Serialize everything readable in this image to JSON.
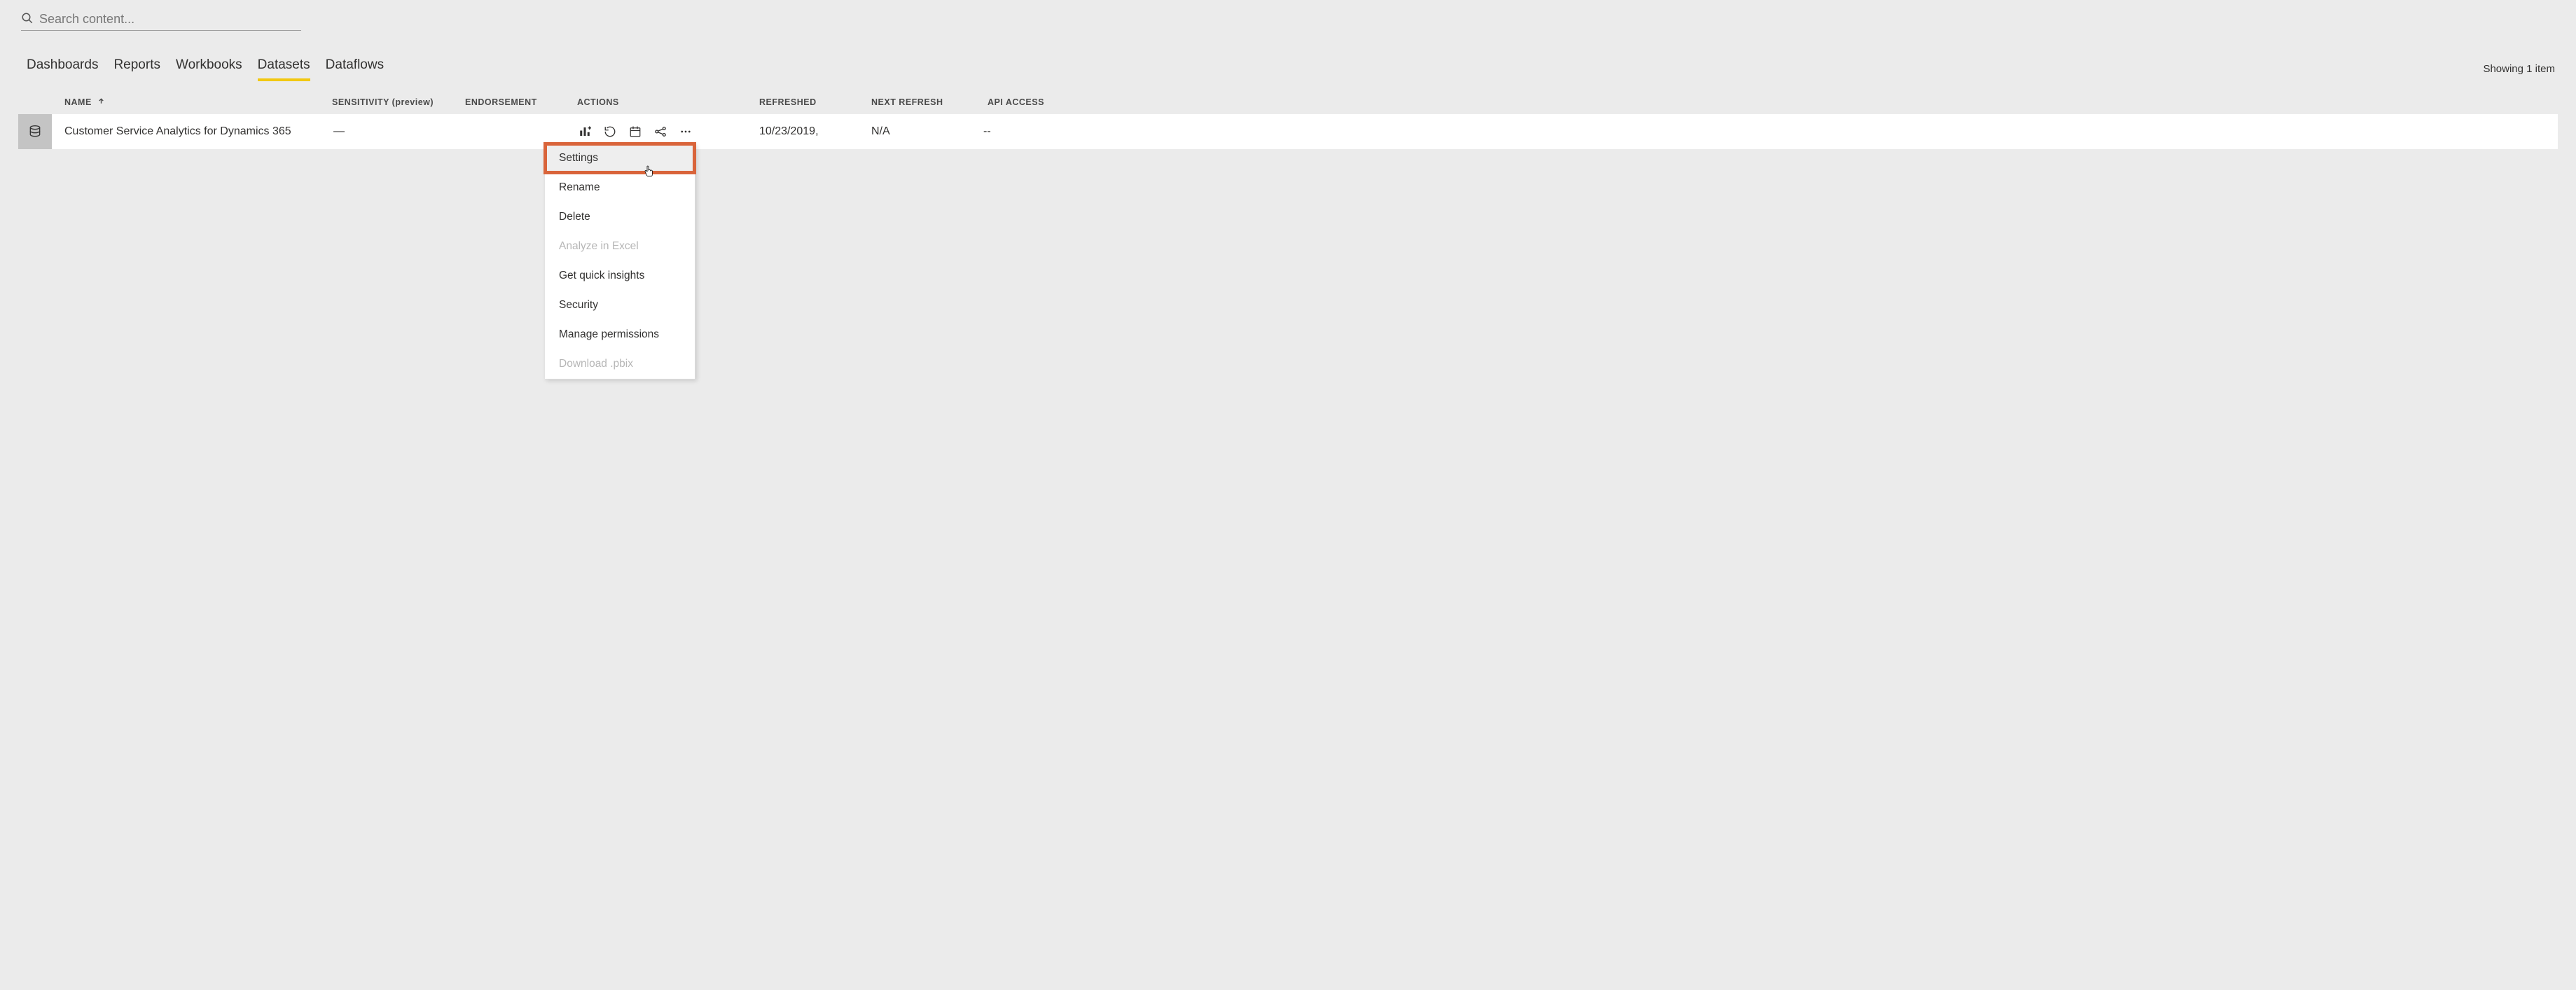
{
  "search": {
    "placeholder": "Search content..."
  },
  "tabs": {
    "items": [
      {
        "label": "Dashboards"
      },
      {
        "label": "Reports"
      },
      {
        "label": "Workbooks"
      },
      {
        "label": "Datasets"
      },
      {
        "label": "Dataflows"
      }
    ],
    "active_index": 3
  },
  "count_label": "Showing 1 item",
  "columns": {
    "name": "NAME",
    "sensitivity": "SENSITIVITY (preview)",
    "endorsement": "ENDORSEMENT",
    "actions": "ACTIONS",
    "refreshed": "REFRESHED",
    "next_refresh": "NEXT REFRESH",
    "api_access": "API ACCESS"
  },
  "rows": [
    {
      "name": "Customer Service Analytics for Dynamics 365",
      "sensitivity": "—",
      "endorsement": "",
      "refreshed": "10/23/2019,",
      "next_refresh": "N/A",
      "api_access": "--"
    }
  ],
  "context_menu": {
    "items": [
      {
        "label": "Settings",
        "disabled": false,
        "highlight": true
      },
      {
        "label": "Rename",
        "disabled": false,
        "highlight": false
      },
      {
        "label": "Delete",
        "disabled": false,
        "highlight": false
      },
      {
        "label": "Analyze in Excel",
        "disabled": true,
        "highlight": false
      },
      {
        "label": "Get quick insights",
        "disabled": false,
        "highlight": false
      },
      {
        "label": "Security",
        "disabled": false,
        "highlight": false
      },
      {
        "label": "Manage permissions",
        "disabled": false,
        "highlight": false
      },
      {
        "label": "Download .pbix",
        "disabled": true,
        "highlight": false
      }
    ]
  }
}
